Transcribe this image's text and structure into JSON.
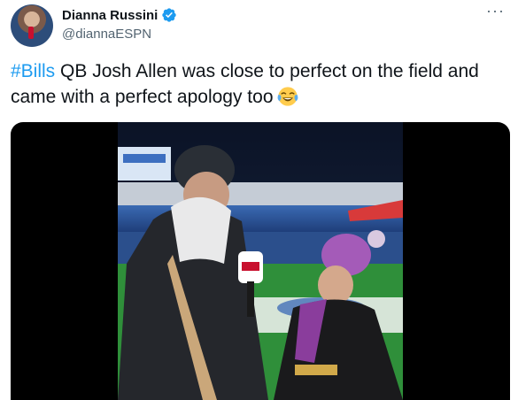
{
  "user": {
    "display_name": "Dianna Russini",
    "handle": "@diannaESPN",
    "verified": true,
    "avatar_icon": "profile-avatar"
  },
  "menu": {
    "more_label": "···"
  },
  "tweet": {
    "hashtag": "#Bills",
    "text_rest": " QB Josh Allen was close to perfect on the field and came with a perfect apology too",
    "emoji": "face-with-tears-of-joy"
  },
  "media": {
    "type": "video",
    "description_icon": "video-thumbnail"
  },
  "colors": {
    "link": "#1d9bf0",
    "verified": "#1d9bf0",
    "secondary_text": "#536471"
  }
}
